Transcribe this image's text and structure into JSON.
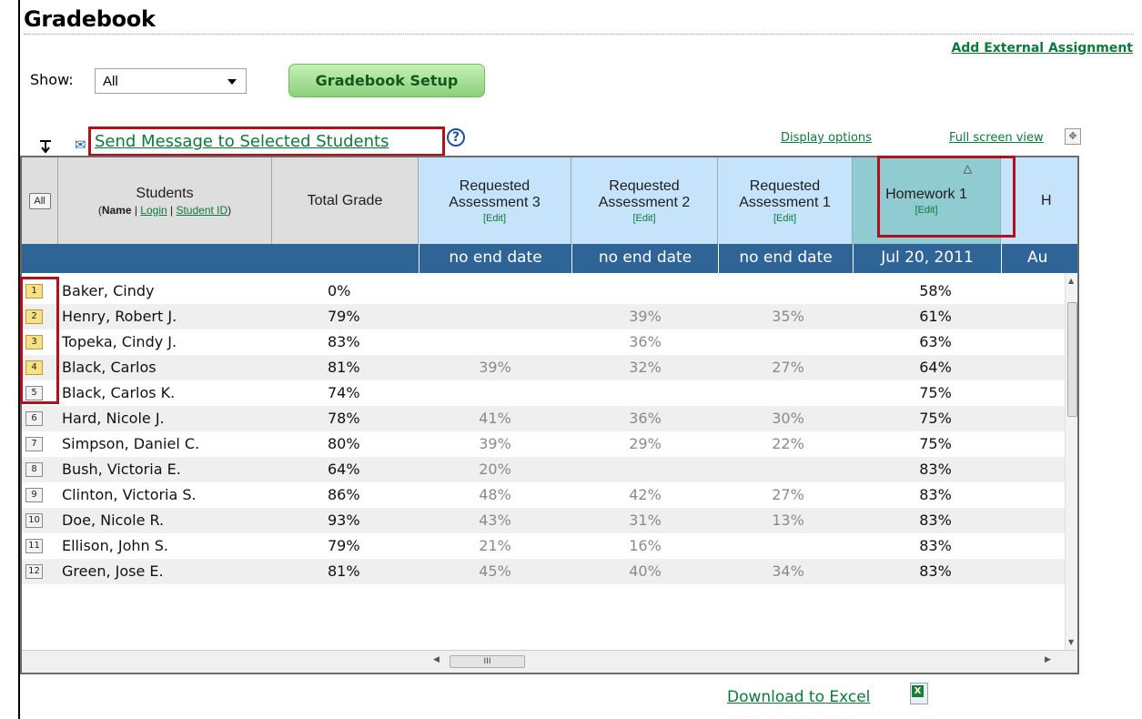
{
  "page": {
    "title": "Gradebook",
    "add_external": "Add External Assignment",
    "show_label": "Show:",
    "show_value": "All",
    "setup_button": "Gradebook Setup",
    "send_message": "Send Message to Selected Students",
    "help": "?",
    "display_options": "Display options",
    "full_screen": "Full screen view",
    "download": "Download to Excel"
  },
  "table": {
    "all_button": "All",
    "students_header": "Students",
    "students_sub_name": "Name",
    "students_sub_login": "Login",
    "students_sub_id": "Student ID",
    "total_header": "Total Grade",
    "columns": [
      {
        "title1": "Requested",
        "title2": "Assessment 3",
        "edit": "[Edit]",
        "date": "no end date"
      },
      {
        "title1": "Requested",
        "title2": "Assessment 2",
        "edit": "[Edit]",
        "date": "no end date"
      },
      {
        "title1": "Requested",
        "title2": "Assessment 1",
        "edit": "[Edit]",
        "date": "no end date"
      },
      {
        "title1": "Homework 1",
        "title2": "",
        "edit": "[Edit]",
        "date": "Jul 20, 2011"
      },
      {
        "title1": "H",
        "title2": "",
        "edit": "",
        "date": "Au"
      }
    ],
    "rows": [
      {
        "num": "1",
        "name": "Baker, Cindy",
        "total": "0%",
        "a3": "",
        "a2": "",
        "a1": "",
        "hw": "58%"
      },
      {
        "num": "2",
        "name": "Henry, Robert J.",
        "total": "79%",
        "a3": "",
        "a2": "39%",
        "a1": "35%",
        "hw": "61%"
      },
      {
        "num": "3",
        "name": "Topeka, Cindy J.",
        "total": "83%",
        "a3": "",
        "a2": "36%",
        "a1": "",
        "hw": "63%"
      },
      {
        "num": "4",
        "name": "Black, Carlos",
        "total": "81%",
        "a3": "39%",
        "a2": "32%",
        "a1": "27%",
        "hw": "64%"
      },
      {
        "num": "5",
        "name": "Black, Carlos K.",
        "total": "74%",
        "a3": "",
        "a2": "",
        "a1": "",
        "hw": "75%"
      },
      {
        "num": "6",
        "name": "Hard, Nicole J.",
        "total": "78%",
        "a3": "41%",
        "a2": "36%",
        "a1": "30%",
        "hw": "75%"
      },
      {
        "num": "7",
        "name": "Simpson, Daniel C.",
        "total": "80%",
        "a3": "39%",
        "a2": "29%",
        "a1": "22%",
        "hw": "75%"
      },
      {
        "num": "8",
        "name": "Bush, Victoria E.",
        "total": "64%",
        "a3": "20%",
        "a2": "",
        "a1": "",
        "hw": "83%"
      },
      {
        "num": "9",
        "name": "Clinton, Victoria S.",
        "total": "86%",
        "a3": "48%",
        "a2": "42%",
        "a1": "27%",
        "hw": "83%"
      },
      {
        "num": "10",
        "name": "Doe, Nicole R.",
        "total": "93%",
        "a3": "43%",
        "a2": "31%",
        "a1": "13%",
        "hw": "83%"
      },
      {
        "num": "11",
        "name": "Ellison, John S.",
        "total": "79%",
        "a3": "21%",
        "a2": "16%",
        "a1": "",
        "hw": "83%"
      },
      {
        "num": "12",
        "name": "Green, Jose E.",
        "total": "81%",
        "a3": "45%",
        "a2": "40%",
        "a1": "34%",
        "hw": "83%"
      }
    ]
  },
  "colors": {
    "link_green": "#0b7a3a",
    "header_blue": "#c5e3fb",
    "header_teal": "#8fcbd0",
    "date_bar": "#2f6496",
    "highlight_red": "#b2111b",
    "selected_row_badge": "#f8e088"
  },
  "icons": [
    "arrow-down-left-icon",
    "envelope-icon",
    "help-icon",
    "fullscreen-icon",
    "excel-icon",
    "sort-triangle-icon"
  ]
}
